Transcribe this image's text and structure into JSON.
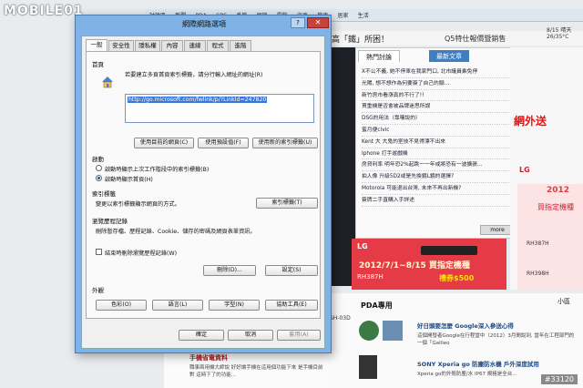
{
  "site": {
    "logo": "MOBILE01",
    "nav_items": [
      "討論區",
      "新聞",
      "PDA",
      "GPS",
      "手機",
      "相機",
      "電腦",
      "汽車",
      "機車",
      "居家",
      "生活"
    ],
    "headline_left": "高「鐵」所困！",
    "headline_right": "Q5特仕報價暨銷售",
    "weather": "8/15 晴天 26/35°C",
    "news_tabs": [
      "熱門討論",
      "最新文章"
    ],
    "news_items": [
      "X不公不義, 她不停車在我家門口, 北市議員乘免停",
      "光陽, 想不想作為何要簽了自己的腳...",
      "新竹房市看漲真的不行了!!",
      "買重機是否會被品牌迷思所誤",
      "DSG的用法（靠嘆說的）",
      "蜜月便civic",
      "Kent 大 大鬼的室技不見得漂不出來",
      "Iphone 打手遊戲機",
      "房貸利率 明年恐2%起跳一一年或將恐有一波擴張...",
      "拍人像 升級5D2或是先換鏡L鏡的選擇?",
      "Motorola 可能退出台灣, 未來不再出新機?",
      "簽牌二手直購入手詳述"
    ],
    "more_label": "more",
    "ad_left": {
      "brand": "LG",
      "date": "2012/7/1~8/15 買指定機種",
      "model": "RH387H",
      "price": "禮券$500"
    },
    "right_col": {
      "promo": "網外送",
      "brand": "LG",
      "year": "2012",
      "buy": "買指定機種",
      "model_1": "RH387H",
      "model_2": "RH398H"
    },
    "pda": {
      "title": "PDA專用",
      "small": "小區",
      "headline_1": "好日頭要怎麼 Google深入參送心得",
      "body_1": "這個開發者Google在行程當中（2012）3月間說到, 當年在工程部門的一個「Galileo",
      "headline_2": "SONY Xperia go 防塵防水機 戶外深度試用",
      "body_2": "Xperia go的外殼防塵/水 IP67 規格是全台..."
    },
    "sh_label": "SH-03D",
    "article": {
      "title": "手機省電資料",
      "body": "職事兩用機大師說 好好讓手機在這用個功能下來 是手機目前對 這時下了的功能..."
    },
    "watermark": "#33120"
  },
  "dialog": {
    "title": "網際網路選項",
    "help_label": "?",
    "close_label": "✕",
    "tabs": [
      "一般",
      "安全性",
      "隱私權",
      "內容",
      "連線",
      "程式",
      "進階"
    ],
    "home": {
      "section": "首頁",
      "description": "若要建立多頁首頁索引標籤，請分行輸入網址的網址(R)",
      "url": "http://go.microsoft.com/fwlink/p/?LinkId=247820",
      "use_current": "使用目前的網頁(C)",
      "use_default": "使用預設值(F)",
      "use_new_tab": "使用新的索引標籤(U)"
    },
    "startup": {
      "section": "啟動",
      "option_last": "啟動時顯示上次工作階段中的索引標籤(B)",
      "option_home": "啟動時顯示首頁(H)"
    },
    "tabs_section": {
      "section": "索引標籤",
      "description": "變更以索引標籤顯示網頁的方式。",
      "button": "索引標籤(T)"
    },
    "history": {
      "section": "瀏覽歷程記錄",
      "description": "刪除暫存檔、歷程記錄、Cookie、儲存的密碼及網頁表單資訊。",
      "checkbox": "結束時刪除瀏覽歷程記錄(W)",
      "delete": "刪除(D)...",
      "settings": "設定(S)"
    },
    "appearance": {
      "section": "外觀",
      "colors": "色彩(O)",
      "languages": "語言(L)",
      "fonts": "字型(N)",
      "accessibility": "協助工具(E)"
    },
    "ok": "確定",
    "cancel": "取消",
    "apply": "套用(A)"
  }
}
